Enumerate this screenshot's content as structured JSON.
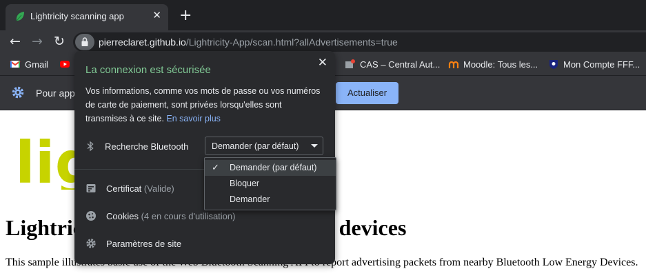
{
  "tab": {
    "title": "Lightricity scanning app",
    "new_tab": "+"
  },
  "address_bar": {
    "host": "pierreclaret.github.io",
    "path": "/Lightricity-App/scan.html?allAdvertisements=true"
  },
  "bookmarks": [
    {
      "label": "Gmail",
      "icon": "gmail-icon"
    },
    {
      "label": "CAS – Central Aut...",
      "icon": "cas-icon"
    },
    {
      "label": "Moodle: Tous les...",
      "icon": "moodle-icon"
    },
    {
      "label": "Mon Compte FFF...",
      "icon": "fff-icon"
    }
  ],
  "infobar": {
    "message": "Pour app",
    "button": "Actualiser"
  },
  "page": {
    "logo_text": "lig",
    "headline": "Lightricity scanning app: scanning devices",
    "intro": "This sample illustrates basic use of the Web Bluetooth Scanning API to report advertising packets from nearby Bluetooth Low Energy Devices."
  },
  "popup": {
    "title": "La connexion est sécurisée",
    "description": "Vos informations, comme vos mots de passe ou vos numéros de carte de paiement, sont privées lorsqu'elles sont transmises à ce site.",
    "learn_more": "En savoir plus",
    "permission": {
      "label": "Recherche Bluetooth",
      "value": "Demander (par défaut)"
    },
    "certificate": {
      "label": "Certificat",
      "status": "(Valide)"
    },
    "cookies": {
      "label": "Cookies",
      "status": "(4 en cours d'utilisation)"
    },
    "site_settings": "Paramètres de site"
  },
  "menu": {
    "options": [
      "Demander (par défaut)",
      "Bloquer",
      "Demander"
    ],
    "selected": "Demander (par défaut)"
  },
  "colors": {
    "accent": "#8ab4f8",
    "secure": "#81c995",
    "logo": "#c7d300",
    "dark": "#292a2d"
  }
}
